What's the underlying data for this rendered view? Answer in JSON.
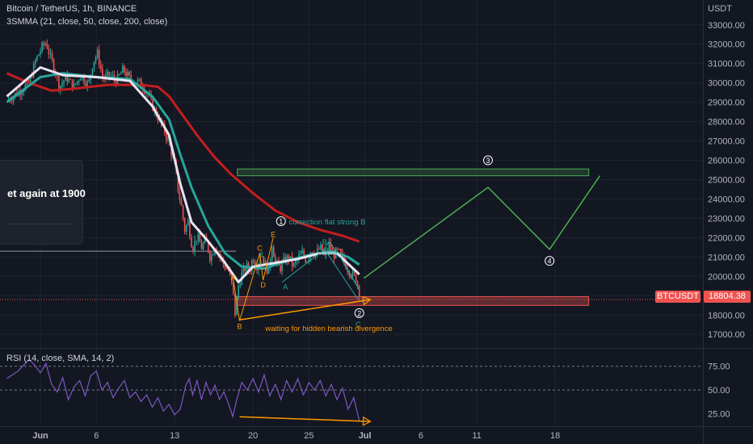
{
  "header": {
    "symbol": "Bitcoin / TetherUS, 1h, BINANCE",
    "indicator": "3SMMA (21, close, 50, close, 200, close)",
    "currency": "USDT"
  },
  "tooltip_text": "et again at 1900",
  "rsi_label": "RSI (14, close, SMA, 14, 2)",
  "price_tag": {
    "symbol": "BTCUSDT",
    "value": "18804.38"
  },
  "colors": {
    "background": "#131722",
    "up": "#26a69a",
    "down": "#ef5350",
    "sma21": "#e8e3f0",
    "sma50": "#26a69a",
    "sma200": "#c21e1e",
    "rsi": "#7e57c2",
    "projection": "#4caf50",
    "annotation_orange": "#ff9800"
  },
  "chart_data": {
    "type": "candlestick",
    "y_axis": {
      "unit": "USDT",
      "range": [
        16300,
        33700
      ],
      "ticks": [
        "33000.00",
        "32000.00",
        "31000.00",
        "30000.00",
        "29000.00",
        "28000.00",
        "27000.00",
        "26000.00",
        "25000.00",
        "24000.00",
        "23000.00",
        "22000.00",
        "21000.00",
        "20000.00",
        "19000.00",
        "18000.00",
        "17000.00"
      ]
    },
    "x_axis": {
      "labels": [
        {
          "text": "Jun",
          "day": 1
        },
        {
          "text": "6",
          "day": 6
        },
        {
          "text": "13",
          "day": 13
        },
        {
          "text": "20",
          "day": 20
        },
        {
          "text": "25",
          "day": 25
        },
        {
          "text": "Jul",
          "day": 30
        },
        {
          "text": "6",
          "day": 35
        },
        {
          "text": "11",
          "day": 40
        },
        {
          "text": "18",
          "day": 47
        }
      ]
    },
    "price_path": [
      [
        -2,
        29100
      ],
      [
        -1,
        29500
      ],
      [
        0,
        30000
      ],
      [
        0.6,
        31200
      ],
      [
        1.1,
        31800
      ],
      [
        1.5,
        32100
      ],
      [
        1.9,
        31300
      ],
      [
        2.3,
        30700
      ],
      [
        2.7,
        29800
      ],
      [
        3.3,
        30300
      ],
      [
        4,
        29800
      ],
      [
        4.6,
        30400
      ],
      [
        5,
        30100
      ],
      [
        5.3,
        29900
      ],
      [
        5.7,
        31100
      ],
      [
        6.1,
        31500
      ],
      [
        6.6,
        30200
      ],
      [
        7.2,
        30400
      ],
      [
        7.8,
        30100
      ],
      [
        8.4,
        30700
      ],
      [
        9,
        30200
      ],
      [
        9.6,
        30100
      ],
      [
        10.1,
        29900
      ],
      [
        10.6,
        29400
      ],
      [
        11.1,
        28700
      ],
      [
        11.6,
        28100
      ],
      [
        12.1,
        27500
      ],
      [
        12.5,
        26800
      ],
      [
        13,
        25800
      ],
      [
        13.3,
        24500
      ],
      [
        13.6,
        23600
      ],
      [
        13.9,
        22400
      ],
      [
        14.2,
        22800
      ],
      [
        14.6,
        21400
      ],
      [
        15,
        22100
      ],
      [
        15.4,
        21500
      ],
      [
        15.8,
        21900
      ],
      [
        16.2,
        20900
      ],
      [
        16.6,
        21600
      ],
      [
        17,
        21100
      ],
      [
        17.4,
        20600
      ],
      [
        17.8,
        20300
      ],
      [
        18.2,
        19300
      ],
      [
        18.4,
        18100
      ],
      [
        18.7,
        19500
      ],
      [
        19,
        20100
      ],
      [
        19.4,
        20500
      ],
      [
        19.7,
        20300
      ],
      [
        20,
        21000
      ],
      [
        20.4,
        20500
      ],
      [
        20.7,
        21300
      ],
      [
        21,
        20700
      ],
      [
        21.4,
        20200
      ],
      [
        21.7,
        21700
      ],
      [
        22,
        20700
      ],
      [
        22.4,
        20400
      ],
      [
        22.8,
        20800
      ],
      [
        23.2,
        21000
      ],
      [
        23.6,
        20500
      ],
      [
        24,
        20900
      ],
      [
        24.4,
        21200
      ],
      [
        24.8,
        20800
      ],
      [
        25.2,
        21400
      ],
      [
        25.6,
        21100
      ],
      [
        26,
        21500
      ],
      [
        26.4,
        21000
      ],
      [
        26.8,
        21600
      ],
      [
        27.2,
        21100
      ],
      [
        27.6,
        21300
      ],
      [
        28,
        20900
      ],
      [
        28.4,
        20500
      ],
      [
        28.8,
        20100
      ],
      [
        29.2,
        19900
      ],
      [
        29.5,
        19200
      ]
    ],
    "sma21_path": [
      [
        -2,
        29300
      ],
      [
        1,
        30800
      ],
      [
        3,
        30400
      ],
      [
        6,
        30300
      ],
      [
        9,
        30100
      ],
      [
        11,
        28800
      ],
      [
        12.5,
        27300
      ],
      [
        13.5,
        24800
      ],
      [
        14.5,
        22800
      ],
      [
        16,
        21800
      ],
      [
        17.5,
        20700
      ],
      [
        18.7,
        19700
      ],
      [
        20,
        20500
      ],
      [
        22,
        20700
      ],
      [
        24,
        20900
      ],
      [
        26,
        21200
      ],
      [
        27.5,
        21200
      ],
      [
        29.5,
        20100
      ]
    ],
    "sma50_path": [
      [
        -2,
        29000
      ],
      [
        1,
        30300
      ],
      [
        3,
        30500
      ],
      [
        6,
        30300
      ],
      [
        9,
        30200
      ],
      [
        11,
        29300
      ],
      [
        12.5,
        28100
      ],
      [
        13.5,
        26300
      ],
      [
        14.5,
        24600
      ],
      [
        16,
        22600
      ],
      [
        17.5,
        21200
      ],
      [
        19,
        20500
      ],
      [
        21,
        20400
      ],
      [
        23,
        20800
      ],
      [
        25,
        21100
      ],
      [
        27,
        21300
      ],
      [
        28.5,
        21000
      ],
      [
        29.5,
        20600
      ]
    ],
    "sma200_path": [
      [
        -2,
        30500
      ],
      [
        0,
        30000
      ],
      [
        2,
        29600
      ],
      [
        4,
        29700
      ],
      [
        7,
        29900
      ],
      [
        10,
        29900
      ],
      [
        11.5,
        29800
      ],
      [
        12.5,
        29300
      ],
      [
        13.5,
        28500
      ],
      [
        15,
        27300
      ],
      [
        16.5,
        26200
      ],
      [
        18,
        25300
      ],
      [
        20,
        24300
      ],
      [
        22,
        23400
      ],
      [
        24,
        22800
      ],
      [
        26,
        22400
      ],
      [
        28,
        22100
      ],
      [
        29.5,
        21800
      ]
    ],
    "rsi": {
      "label": "RSI (14, close, SMA, 14, 2)",
      "range": [
        12,
        90
      ],
      "levels": [
        75,
        50
      ],
      "ticks": [
        "75.00",
        "50.00",
        "25.00"
      ],
      "path": [
        [
          -2,
          62
        ],
        [
          -1,
          70
        ],
        [
          0,
          82
        ],
        [
          0.5,
          76
        ],
        [
          1,
          68
        ],
        [
          1.5,
          78
        ],
        [
          2,
          56
        ],
        [
          2.5,
          48
        ],
        [
          3,
          63
        ],
        [
          3.5,
          40
        ],
        [
          4,
          53
        ],
        [
          4.5,
          60
        ],
        [
          5,
          44
        ],
        [
          5.5,
          65
        ],
        [
          6,
          70
        ],
        [
          6.5,
          50
        ],
        [
          7,
          58
        ],
        [
          7.5,
          42
        ],
        [
          8,
          52
        ],
        [
          8.5,
          60
        ],
        [
          9,
          42
        ],
        [
          9.5,
          48
        ],
        [
          10,
          38
        ],
        [
          10.5,
          45
        ],
        [
          11,
          32
        ],
        [
          11.5,
          42
        ],
        [
          12,
          28
        ],
        [
          12.5,
          35
        ],
        [
          13,
          24
        ],
        [
          13.5,
          30
        ],
        [
          14,
          55
        ],
        [
          14.3,
          62
        ],
        [
          14.6,
          45
        ],
        [
          15,
          60
        ],
        [
          15.4,
          40
        ],
        [
          15.8,
          58
        ],
        [
          16.2,
          45
        ],
        [
          16.6,
          55
        ],
        [
          17,
          40
        ],
        [
          17.4,
          48
        ],
        [
          17.8,
          36
        ],
        [
          18.2,
          22
        ],
        [
          18.5,
          38
        ],
        [
          19,
          58
        ],
        [
          19.5,
          50
        ],
        [
          20,
          62
        ],
        [
          20.5,
          48
        ],
        [
          21,
          66
        ],
        [
          21.5,
          44
        ],
        [
          22,
          56
        ],
        [
          22.5,
          40
        ],
        [
          23,
          60
        ],
        [
          23.5,
          48
        ],
        [
          24,
          62
        ],
        [
          24.5,
          45
        ],
        [
          25,
          58
        ],
        [
          25.5,
          50
        ],
        [
          26,
          60
        ],
        [
          26.5,
          44
        ],
        [
          27,
          56
        ],
        [
          27.5,
          40
        ],
        [
          28,
          52
        ],
        [
          28.5,
          30
        ],
        [
          29,
          42
        ],
        [
          29.5,
          18
        ]
      ]
    },
    "annotations": {
      "wave_labels": [
        {
          "text": "1",
          "day": 22.5,
          "price": 22850,
          "style": "circle"
        },
        {
          "text": "2",
          "day": 29.5,
          "price": 18100,
          "style": "circle"
        },
        {
          "text": "3",
          "day": 41,
          "price": 26000,
          "style": "circle"
        },
        {
          "text": "4",
          "day": 46.5,
          "price": 20800,
          "style": "circle"
        }
      ],
      "letters": [
        {
          "text": "A",
          "day": 18.2,
          "price": 20000,
          "color": "#ff9800"
        },
        {
          "text": "B",
          "day": 18.8,
          "price": 17450,
          "color": "#ff9800"
        },
        {
          "text": "C",
          "day": 20.6,
          "price": 21500,
          "color": "#ff9800"
        },
        {
          "text": "D",
          "day": 20.9,
          "price": 19600,
          "color": "#ff9800"
        },
        {
          "text": "E",
          "day": 21.8,
          "price": 22200,
          "color": "#ff9800"
        },
        {
          "text": "A",
          "day": 22.9,
          "price": 19500,
          "color": "#26a69a"
        },
        {
          "text": "B",
          "day": 26.4,
          "price": 21800,
          "color": "#26a69a"
        },
        {
          "text": "C",
          "day": 29.4,
          "price": 17550,
          "color": "#26a69a"
        }
      ],
      "texts": [
        {
          "text": "correction flat strong B",
          "day": 23.2,
          "price": 22850,
          "color": "#26a69a"
        },
        {
          "text": "waiting for hidden bearish divergence",
          "day": 21.1,
          "price": 17350,
          "color": "#ff9800"
        }
      ],
      "zones": [
        {
          "day_from": 18.6,
          "day_to": 50,
          "price_from": 25200,
          "price_to": 25550,
          "color": "green"
        },
        {
          "day_from": 18.6,
          "day_to": 50,
          "price_from": 18500,
          "price_to": 18950,
          "color": "red"
        }
      ],
      "projection": [
        [
          29.9,
          19900
        ],
        [
          41,
          24600
        ],
        [
          46.5,
          21400
        ],
        [
          51,
          25200
        ]
      ],
      "horizontal_line": {
        "price": 21300,
        "day_to": 18.5
      },
      "divergence_price": [
        [
          18.8,
          17750
        ],
        [
          30.5,
          18800
        ]
      ],
      "divergence_rsi": [
        [
          18.8,
          22
        ],
        [
          30.5,
          17
        ]
      ],
      "flat_triangle": [
        [
          26.1,
          21200
        ],
        [
          26.8,
          21800
        ],
        [
          27.5,
          21200
        ]
      ],
      "flat_arrow": [
        [
          27.8,
          21000
        ],
        [
          29.5,
          19300
        ]
      ],
      "orange_zigzag": [
        [
          18.2,
          20000
        ],
        [
          18.8,
          17700
        ],
        [
          20.6,
          21200
        ],
        [
          20.9,
          19800
        ],
        [
          21.8,
          22000
        ]
      ],
      "teal_zigzag": [
        [
          22.6,
          19700
        ],
        [
          26.4,
          21400
        ],
        [
          29.4,
          18800
        ]
      ]
    }
  }
}
